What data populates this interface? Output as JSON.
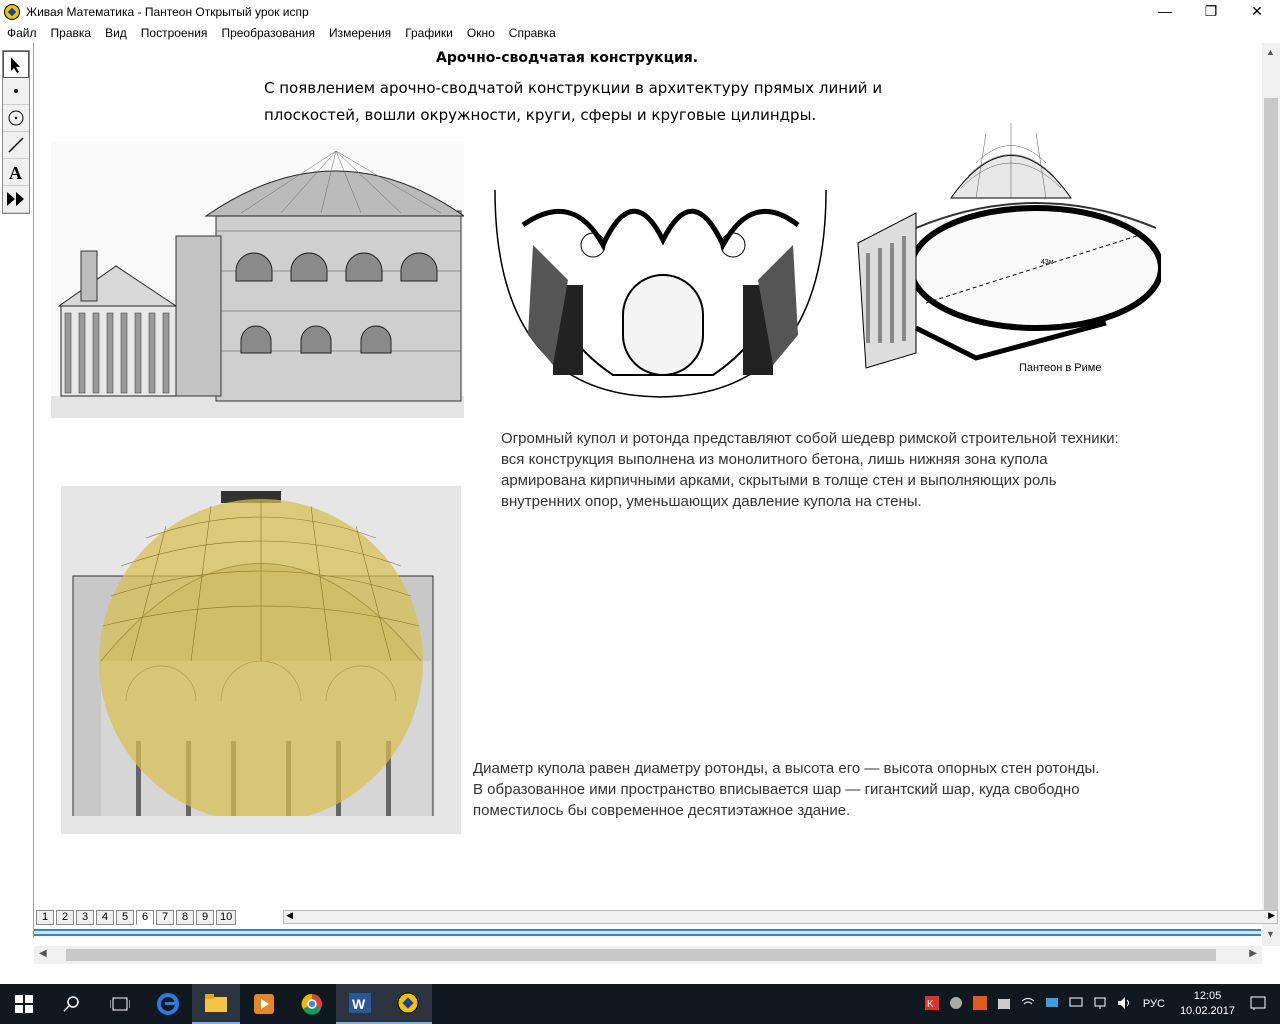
{
  "window": {
    "title": "Живая Математика - Пантеон Открытый урок испр",
    "controls": {
      "minimize": "—",
      "maximize": "❐",
      "close": "✕"
    }
  },
  "menu": [
    "Файл",
    "Правка",
    "Вид",
    "Построения",
    "Преобразования",
    "Измерения",
    "Графики",
    "Окно",
    "Справка"
  ],
  "tools": [
    "arrow-tool",
    "point-tool",
    "compass-tool",
    "straightedge-tool",
    "text-tool",
    "custom-tool"
  ],
  "content": {
    "heading": "Арочно-сводчатая конструкция.",
    "intro": "С появлением арочно-сводчатой конструкции в архитектуру прямых линий и плоскостей, вошли окружности, круги, сферы и круговые цилиндры.",
    "paragraph1": "Огромный купол и ротонда представляют собой шедевр римской строительной техники: вся конструкция выполнена из монолитного бетона, лишь нижняя зона купола армирована кирпичными арками,  скрытыми в толще стен и выполняющих роль внутренних опор, уменьшающих давление купола на стены.",
    "paragraph2": "Диаметр купола равен диаметру ротонды, а высота его — высота опорных стен ротонды. В образованное ими пространство вписывается шар — гигантский шар, куда свободно поместилось бы современное десятиэтажное здание.",
    "plan_caption": "Пантеон в Риме",
    "plan_measure": "43м"
  },
  "pages": {
    "tabs": [
      "1",
      "2",
      "3",
      "4",
      "5",
      "6",
      "7",
      "8",
      "9",
      "10"
    ],
    "active": "6"
  },
  "tray": {
    "language": "РУС",
    "time": "12:05",
    "date": "10.02.2017"
  }
}
